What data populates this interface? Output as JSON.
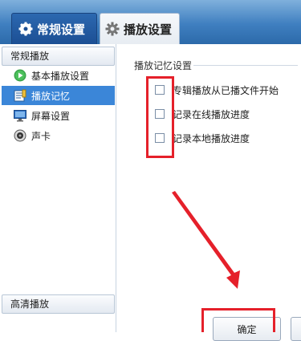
{
  "tabs": [
    {
      "label": "常规设置",
      "icon": "gear-icon",
      "active": true
    },
    {
      "label": "播放设置",
      "icon": "gear-icon",
      "active": false
    }
  ],
  "sidebar": {
    "section_top": "常规播放",
    "items": [
      {
        "label": "基本播放设置",
        "icon": "play-icon"
      },
      {
        "label": "播放记忆",
        "icon": "memory-icon",
        "selected": true
      },
      {
        "label": "屏幕设置",
        "icon": "screen-icon"
      },
      {
        "label": "声卡",
        "icon": "speaker-icon"
      }
    ],
    "section_bottom": "高清播放"
  },
  "content": {
    "group_title": "播放记忆设置",
    "options": [
      {
        "label": "专辑播放从已播文件开始",
        "checked": false
      },
      {
        "label": "记录在线播放进度",
        "checked": false
      },
      {
        "label": "记录本地播放进度",
        "checked": false
      }
    ],
    "ok_label": "确定"
  },
  "colors": {
    "highlight": "#e5202a",
    "selected_bg": "#3b86d8",
    "topbar": "#3f7fc0"
  }
}
